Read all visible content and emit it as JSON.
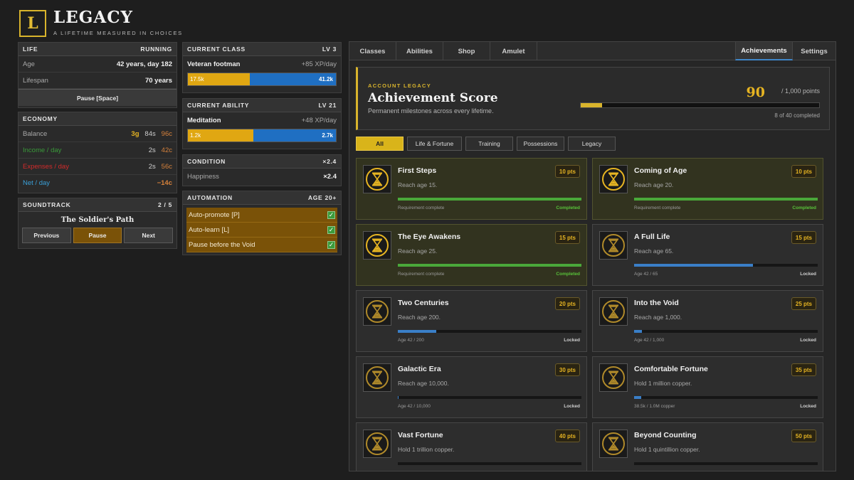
{
  "brand": {
    "logo_letter": "L",
    "title": "LEGACY",
    "subtitle": "A LIFETIME MEASURED IN CHOICES"
  },
  "life": {
    "header": "LIFE",
    "status": "RUNNING",
    "age_label": "Age",
    "age_value": "42 years, day 182",
    "lifespan_label": "Lifespan",
    "lifespan_value": "70 years",
    "pause_button": "Pause [Space]"
  },
  "economy": {
    "header": "ECONOMY",
    "balance_label": "Balance",
    "balance_gold": "3g",
    "balance_silver": "84s",
    "balance_copper": "96c",
    "income_label": "Income / day",
    "income_silver": "2s",
    "income_copper": "42c",
    "expenses_label": "Expenses / day",
    "expenses_silver": "2s",
    "expenses_copper": "56c",
    "net_label": "Net / day",
    "net_value": "−14c"
  },
  "soundtrack": {
    "header": "SOUNDTRACK",
    "track_index": "2 / 5",
    "track_title": "The Soldier's Path",
    "previous": "Previous",
    "pause": "Pause",
    "next": "Next"
  },
  "current_class": {
    "header": "CURRENT CLASS",
    "level": "LV 3",
    "name": "Veteran footman",
    "rate": "+85 XP/day",
    "xp_current": "17.5k",
    "xp_needed": "41.2k",
    "progress": 0.42
  },
  "current_ability": {
    "header": "CURRENT ABILITY",
    "level": "LV 21",
    "name": "Meditation",
    "rate": "+48 XP/day",
    "xp_current": "1.2k",
    "xp_needed": "2.7k",
    "progress": 0.44
  },
  "condition": {
    "header": "CONDITION",
    "multiplier": "×2.4",
    "happiness_label": "Happiness",
    "happiness_value": "×2.4"
  },
  "automation": {
    "header": "AUTOMATION",
    "unlock": "AGE 20+",
    "items": [
      "Auto-promote [P]",
      "Auto-learn [L]",
      "Pause before the Void"
    ]
  },
  "tabs": {
    "classes": "Classes",
    "abilities": "Abilities",
    "shop": "Shop",
    "amulet": "Amulet",
    "achievements": "Achievements",
    "settings": "Settings"
  },
  "score": {
    "kicker": "ACCOUNT LEGACY",
    "title": "Achievement Score",
    "subtitle": "Permanent milestones across every lifetime.",
    "points": "90",
    "out_of": "/ 1,000 points",
    "completed": "8 of 40 completed",
    "progress": 0.09
  },
  "filters": [
    "All",
    "Life & Fortune",
    "Training",
    "Possessions",
    "Legacy"
  ],
  "achievements": [
    {
      "name": "First Steps",
      "desc": "Reach age 15.",
      "pts": "10 pts",
      "progress_label": "Requirement complete",
      "status": "Completed",
      "progress": 1.0,
      "done": true
    },
    {
      "name": "Coming of Age",
      "desc": "Reach age 20.",
      "pts": "10 pts",
      "progress_label": "Requirement complete",
      "status": "Completed",
      "progress": 1.0,
      "done": true
    },
    {
      "name": "The Eye Awakens",
      "desc": "Reach age 25.",
      "pts": "15 pts",
      "progress_label": "Requirement complete",
      "status": "Completed",
      "progress": 1.0,
      "done": true
    },
    {
      "name": "A Full Life",
      "desc": "Reach age 65.",
      "pts": "15 pts",
      "progress_label": "Age 42 / 65",
      "status": "Locked",
      "progress": 0.646,
      "done": false
    },
    {
      "name": "Two Centuries",
      "desc": "Reach age 200.",
      "pts": "20 pts",
      "progress_label": "Age 42 / 200",
      "status": "Locked",
      "progress": 0.21,
      "done": false
    },
    {
      "name": "Into the Void",
      "desc": "Reach age 1,000.",
      "pts": "25 pts",
      "progress_label": "Age 42 / 1,000",
      "status": "Locked",
      "progress": 0.042,
      "done": false
    },
    {
      "name": "Galactic Era",
      "desc": "Reach age 10,000.",
      "pts": "30 pts",
      "progress_label": "Age 42 / 10,000",
      "status": "Locked",
      "progress": 0.004,
      "done": false
    },
    {
      "name": "Comfortable Fortune",
      "desc": "Hold 1 million copper.",
      "pts": "35 pts",
      "progress_label": "38.5k / 1.0M copper",
      "status": "Locked",
      "progress": 0.0385,
      "done": false
    },
    {
      "name": "Vast Fortune",
      "desc": "Hold 1 trillion copper.",
      "pts": "40 pts",
      "progress_label": "",
      "status": "",
      "progress": 0.0,
      "done": false
    },
    {
      "name": "Beyond Counting",
      "desc": "Hold 1 quintillion copper.",
      "pts": "50 pts",
      "progress_label": "",
      "status": "",
      "progress": 0.0,
      "done": false
    }
  ],
  "colors": {
    "accent": "#d9b42c",
    "complete": "#4aa83a",
    "progress": "#3a7fc8",
    "xp_gold": "#e0a712",
    "xp_blue": "#1f6fc2"
  }
}
